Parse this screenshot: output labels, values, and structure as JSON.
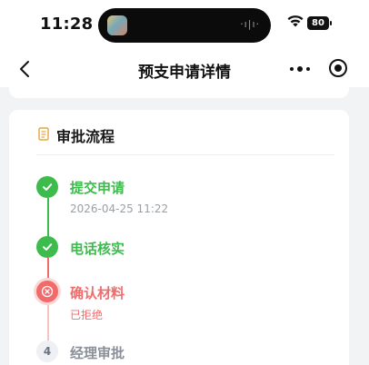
{
  "status_bar": {
    "time": "11:28",
    "battery": "80",
    "island_indicator": "·ı|ı·"
  },
  "nav": {
    "title": "预支申请详情"
  },
  "approval": {
    "section_title": "审批流程",
    "steps": [
      {
        "title": "提交申请",
        "subtitle": "2026-04-25 11:22",
        "state": "done"
      },
      {
        "title": "电话核实",
        "subtitle": "",
        "state": "done"
      },
      {
        "title": "确认材料",
        "subtitle": "已拒绝",
        "state": "rejected"
      },
      {
        "title": "经理审批",
        "number": "4",
        "subtitle": "",
        "state": "pending"
      }
    ]
  },
  "colors": {
    "success": "#3dbb4d",
    "rejected": "#f26b6b",
    "pending": "#8a8f99",
    "background": "#f2f3f5"
  },
  "icons": {
    "back": "chevron-left-icon",
    "more": "more-dots-icon",
    "record": "record-icon",
    "doc": "document-icon",
    "check": "check-icon",
    "reject": "close-circle-icon",
    "wifi": "wifi-icon"
  }
}
